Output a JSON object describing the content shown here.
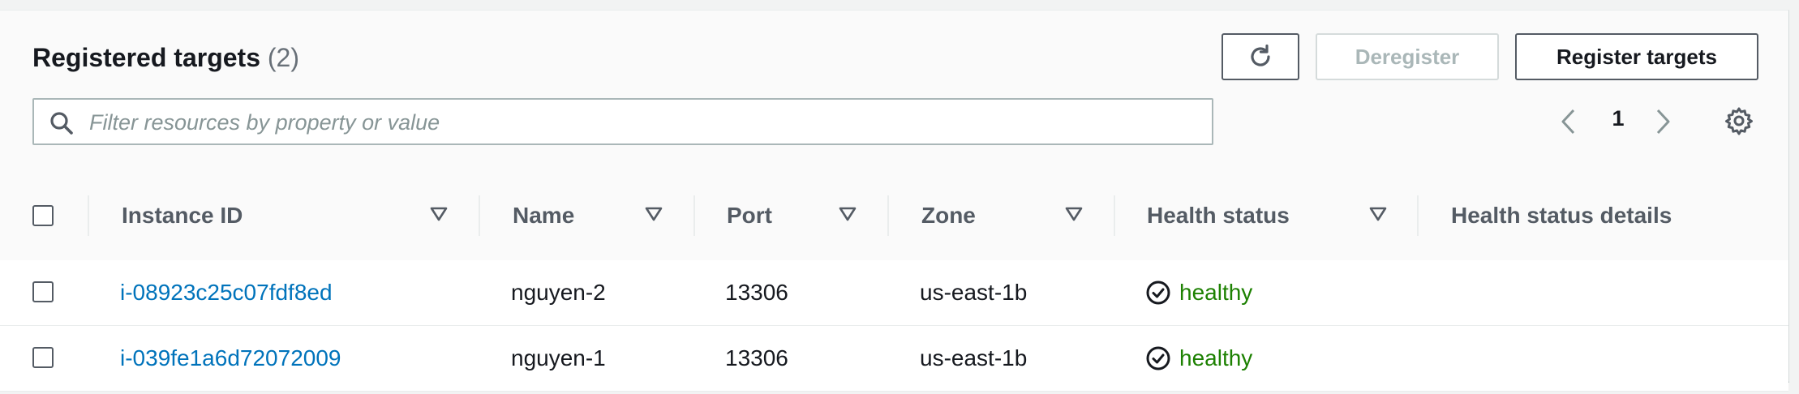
{
  "header": {
    "title": "Registered targets",
    "count": "(2)",
    "deregister_label": "Deregister",
    "register_label": "Register targets",
    "refresh_icon": "refresh-icon"
  },
  "search": {
    "placeholder": "Filter resources by property or value",
    "value": ""
  },
  "pagination": {
    "current_page": "1"
  },
  "columns": [
    {
      "label": "Instance ID"
    },
    {
      "label": "Name"
    },
    {
      "label": "Port"
    },
    {
      "label": "Zone"
    },
    {
      "label": "Health status"
    },
    {
      "label": "Health status details"
    }
  ],
  "rows": [
    {
      "instance_id": "i-08923c25c07fdf8ed",
      "name": "nguyen-2",
      "port": "13306",
      "zone": "us-east-1b",
      "health": "healthy",
      "details": ""
    },
    {
      "instance_id": "i-039fe1a6d72072009",
      "name": "nguyen-1",
      "port": "13306",
      "zone": "us-east-1b",
      "health": "healthy",
      "details": ""
    }
  ],
  "colors": {
    "link": "#0073bb",
    "healthy": "#1d8102",
    "primary_text": "#16191f",
    "secondary_text": "#545b64",
    "disabled": "#aab7b8"
  }
}
